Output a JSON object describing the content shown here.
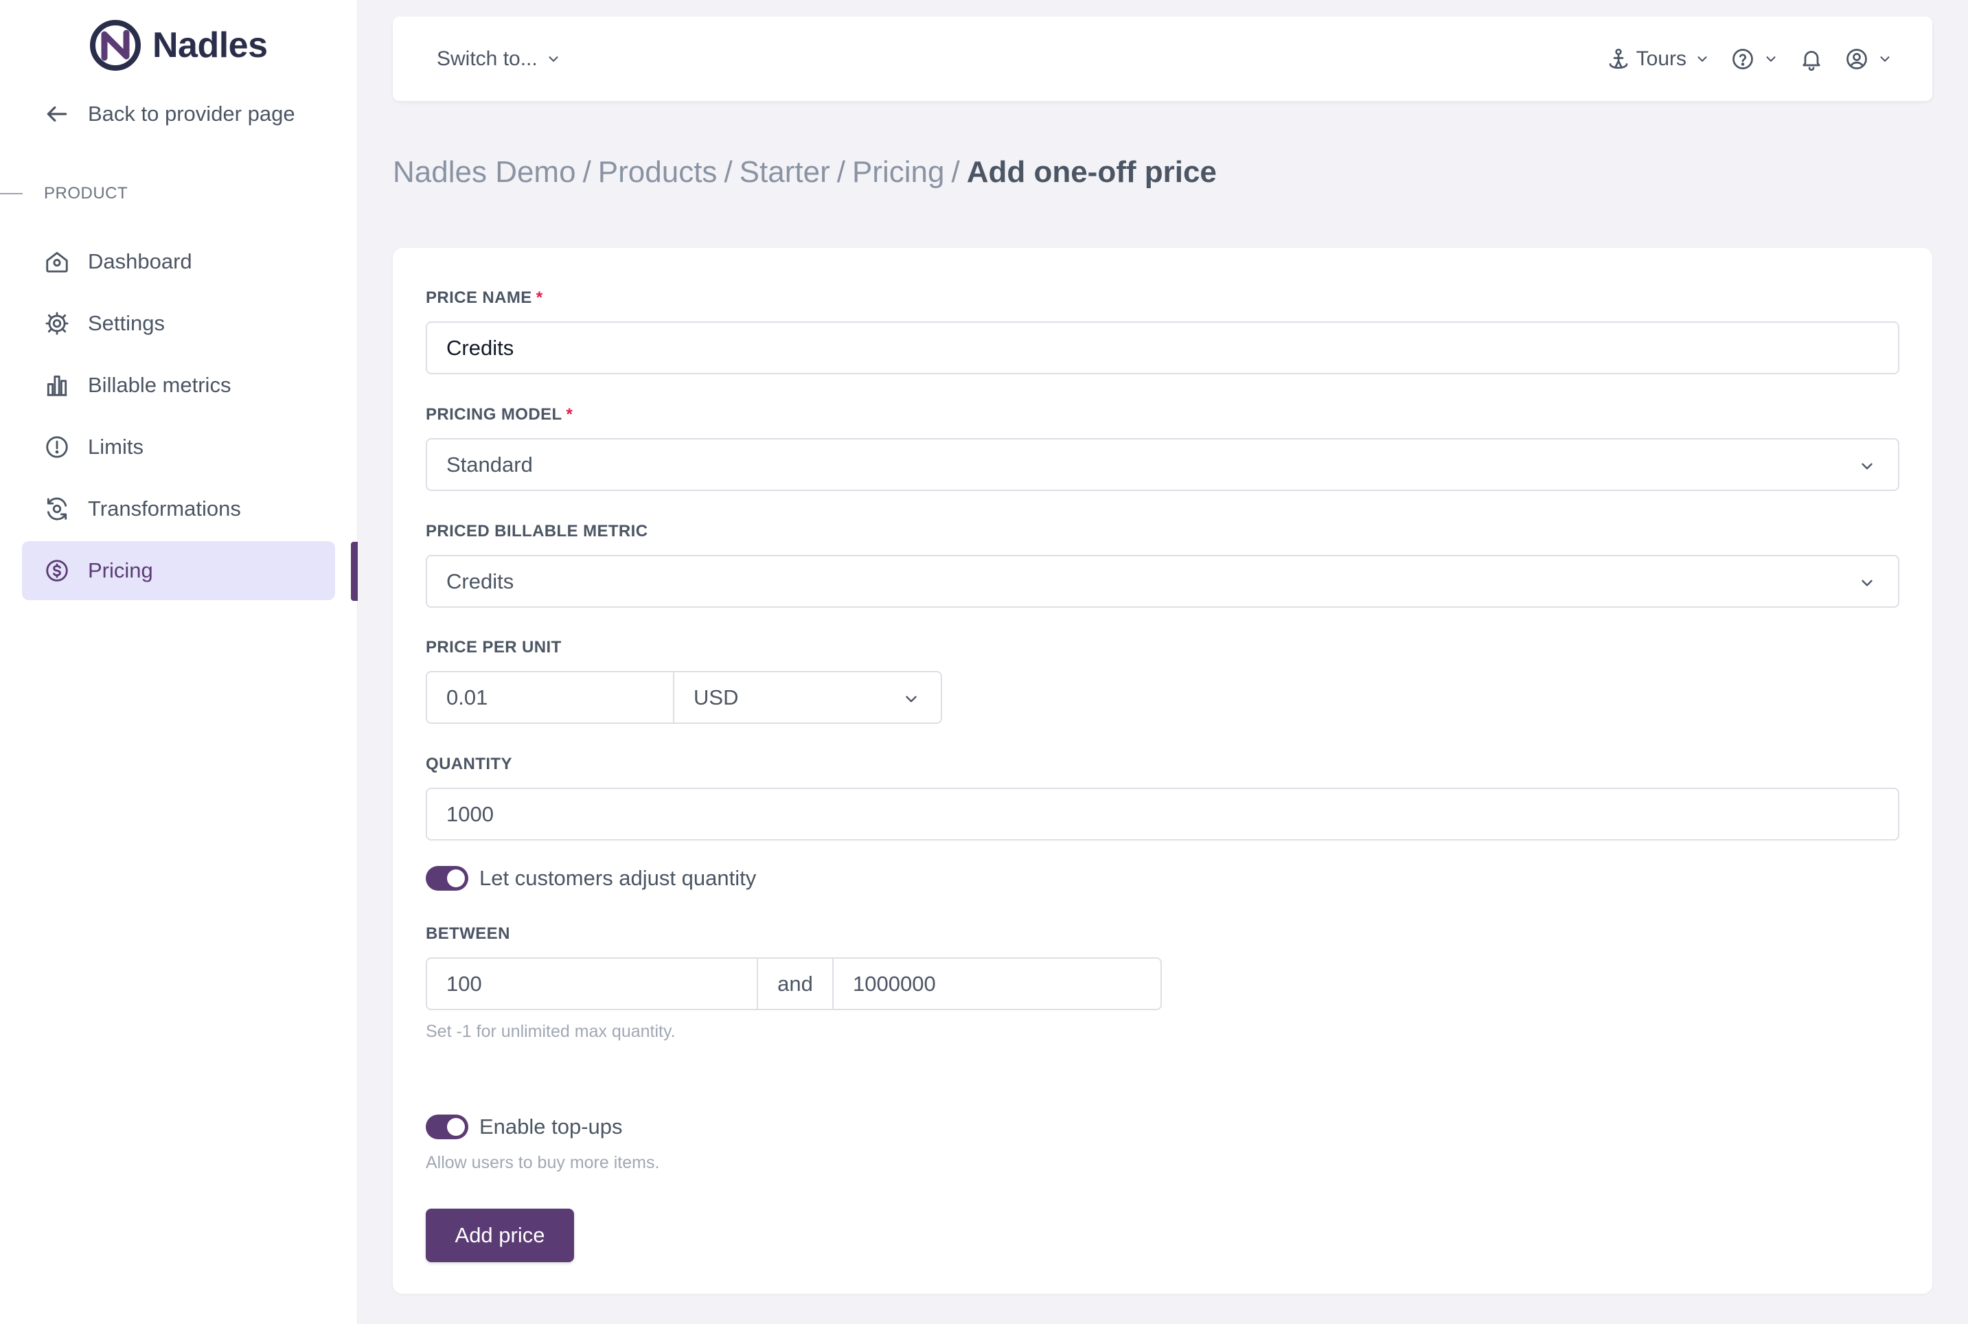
{
  "app": {
    "name": "Nadles",
    "brand_color": "#5b3b74"
  },
  "sidebar": {
    "back_label": "Back to provider page",
    "section_label": "PRODUCT",
    "items": [
      {
        "label": "Dashboard",
        "icon": "home-icon",
        "active": false
      },
      {
        "label": "Settings",
        "icon": "gear-icon",
        "active": false
      },
      {
        "label": "Billable metrics",
        "icon": "bar-chart-icon",
        "active": false
      },
      {
        "label": "Limits",
        "icon": "alert-circle-icon",
        "active": false
      },
      {
        "label": "Transformations",
        "icon": "transform-icon",
        "active": false
      },
      {
        "label": "Pricing",
        "icon": "dollar-circle-icon",
        "active": true
      }
    ]
  },
  "topbar": {
    "switch_label": "Switch to...",
    "tours_label": "Tours"
  },
  "breadcrumb": {
    "items": [
      "Nadles Demo",
      "Products",
      "Starter",
      "Pricing"
    ],
    "separator": "/",
    "current": "Add one-off price"
  },
  "form": {
    "price_name": {
      "label": "PRICE NAME",
      "required_mark": "*",
      "value": "Credits"
    },
    "pricing_model": {
      "label": "PRICING MODEL",
      "required_mark": "*",
      "value": "Standard"
    },
    "billable_metric": {
      "label": "PRICED BILLABLE METRIC",
      "value": "Credits"
    },
    "price_per_unit": {
      "label": "PRICE PER UNIT",
      "value": "0.01",
      "currency": "USD"
    },
    "quantity": {
      "label": "QUANTITY",
      "value": "1000"
    },
    "adjust_quantity": {
      "label": "Let customers adjust quantity",
      "enabled": true
    },
    "between": {
      "label": "BETWEEN",
      "min": "100",
      "connector": "and",
      "max": "1000000",
      "help": "Set -1 for unlimited max quantity."
    },
    "top_ups": {
      "label": "Enable top-ups",
      "enabled": true,
      "help": "Allow users to buy more items."
    },
    "submit_label": "Add price"
  }
}
